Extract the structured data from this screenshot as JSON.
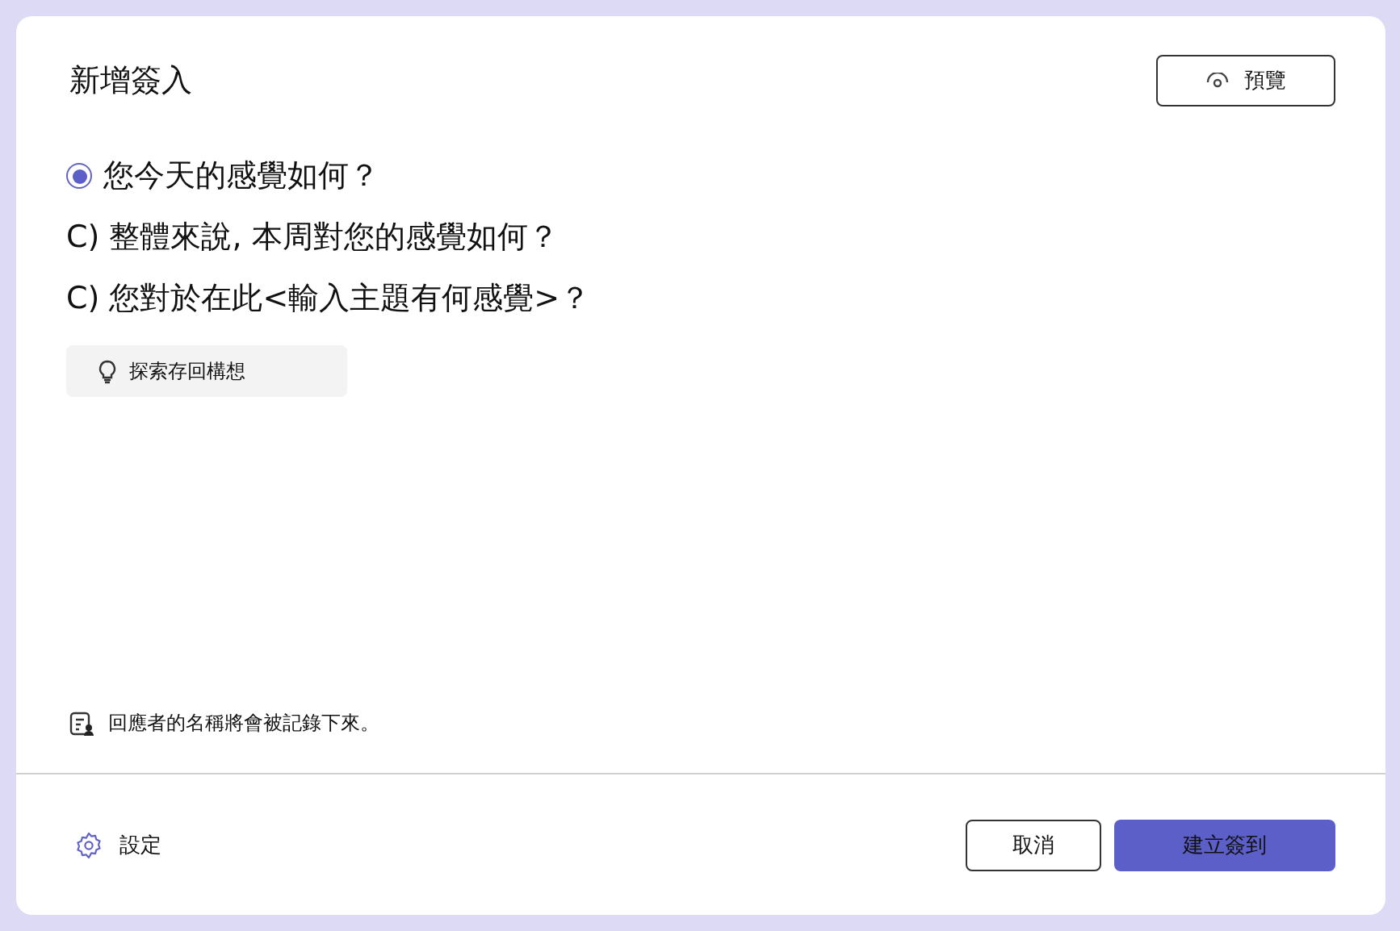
{
  "dialog": {
    "title": "新增簽入",
    "preview_button": "預覽"
  },
  "questions": [
    {
      "kind": "radio",
      "selected": true,
      "text": "您今天的感覺如何？"
    },
    {
      "kind": "plain",
      "text": "C) 整體來說, 本周對您的感覺如何？"
    },
    {
      "kind": "plain",
      "text": "C) 您對於在此<輸入主題有何感覺>？"
    }
  ],
  "ideas_button": "探索存回構想",
  "note": "回應者的名稱將會被記錄下來。",
  "footer": {
    "settings": "設定",
    "cancel": "取消",
    "create": "建立簽到"
  }
}
